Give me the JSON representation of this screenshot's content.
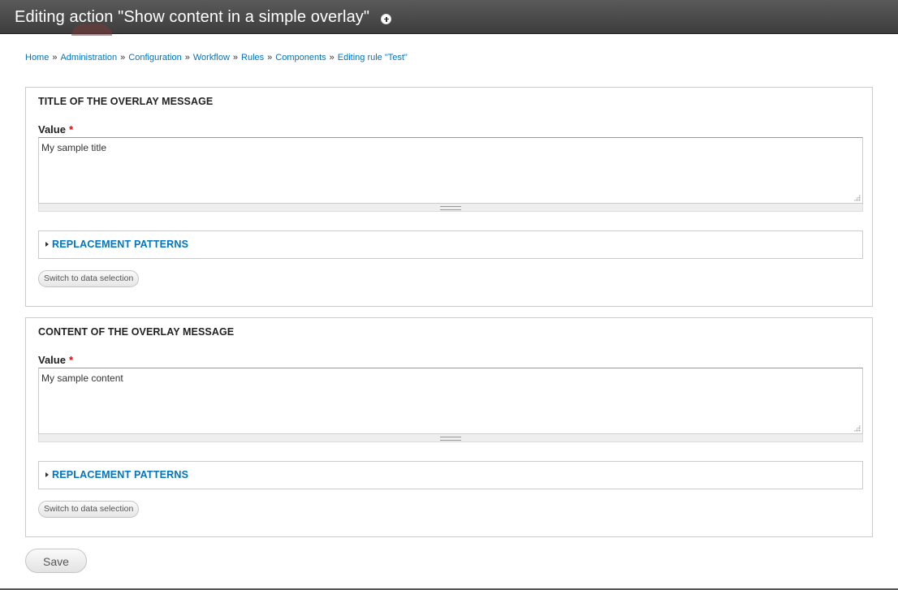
{
  "page_title": "Editing action \"Show content in a simple overlay\"",
  "icons": {
    "shortcut": "add-shortcut-icon",
    "expand": "caret-right-icon",
    "resize": "resize-grip-icon"
  },
  "breadcrumb": [
    {
      "label": "Home"
    },
    {
      "label": "Administration"
    },
    {
      "label": "Configuration"
    },
    {
      "label": "Workflow"
    },
    {
      "label": "Rules"
    },
    {
      "label": "Components"
    },
    {
      "label": "Editing rule \"Test\""
    }
  ],
  "breadcrumb_separator": "»",
  "fieldsets": [
    {
      "legend": "TITLE OF THE OVERLAY MESSAGE",
      "field_label": "Value",
      "required_marker": "*",
      "value": "My sample title",
      "patterns_label": "REPLACEMENT PATTERNS",
      "switch_label": "Switch to data selection"
    },
    {
      "legend": "CONTENT OF THE OVERLAY MESSAGE",
      "field_label": "Value",
      "required_marker": "*",
      "value": "My sample content",
      "patterns_label": "REPLACEMENT PATTERNS",
      "switch_label": "Switch to data selection"
    }
  ],
  "save_label": "Save",
  "colors": {
    "link": "#0074bd",
    "required": "#ee0000",
    "header_bg": "#4a4a4a"
  }
}
